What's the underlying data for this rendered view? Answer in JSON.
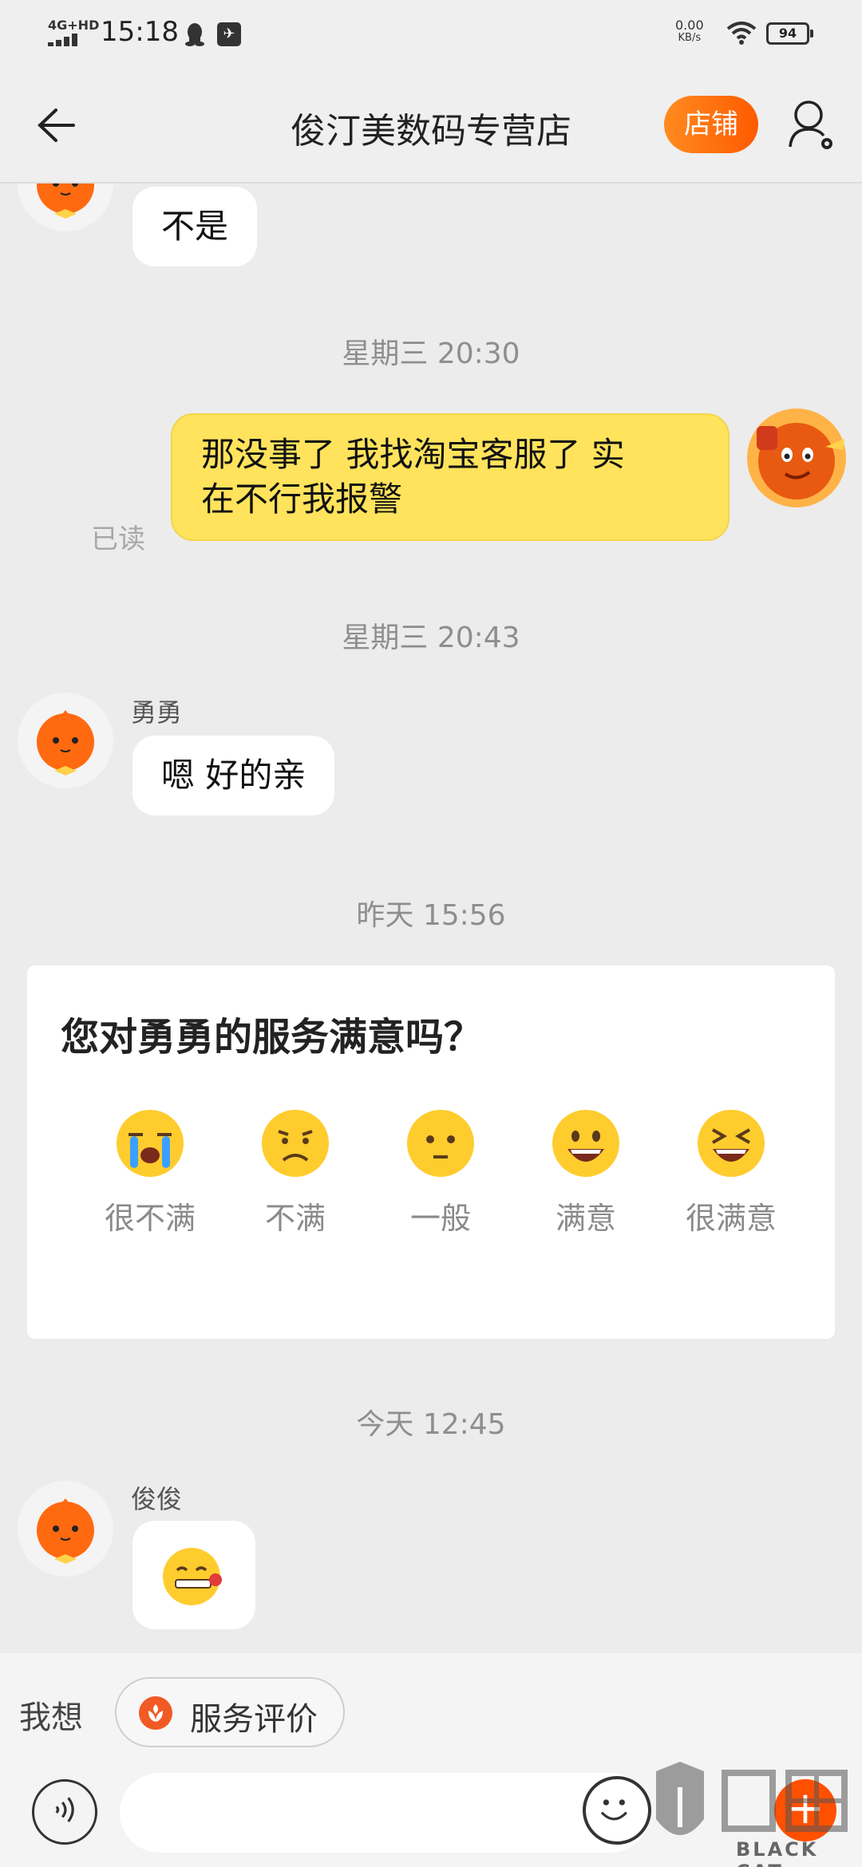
{
  "status_bar": {
    "network": "4G+HD",
    "time": "15:18",
    "speed_value": "0.00",
    "speed_unit": "KB/s",
    "battery": "94"
  },
  "header": {
    "title": "俊汀美数码专营店",
    "shop_button": "店铺"
  },
  "chat": {
    "messages": [
      {
        "type": "text",
        "from": "other",
        "text": "不是"
      },
      {
        "type": "time",
        "text": "星期三 20:30"
      },
      {
        "type": "text",
        "from": "me",
        "line1": "那没事了 我找淘宝客服了 实",
        "line2": "在不行我报警",
        "read": "已读"
      },
      {
        "type": "time",
        "text": "星期三 20:43"
      },
      {
        "type": "text",
        "from": "other",
        "sender": "勇勇",
        "text": "嗯  好的亲"
      },
      {
        "type": "time",
        "text": "昨天  15:56"
      },
      {
        "type": "time",
        "text": "今天  12:45"
      },
      {
        "type": "sticker",
        "from": "other",
        "sender": "俊俊",
        "icon": "blowing-kiss-emoji"
      }
    ],
    "rating": {
      "question": "您对勇勇的服务满意吗？",
      "options": [
        {
          "label": "很不满",
          "icon": "crying-face-icon"
        },
        {
          "label": "不满",
          "icon": "frowning-face-icon"
        },
        {
          "label": "一般",
          "icon": "neutral-face-icon"
        },
        {
          "label": "满意",
          "icon": "smiling-face-icon"
        },
        {
          "label": "很满意",
          "icon": "laughing-face-icon"
        }
      ]
    }
  },
  "quick_bar": {
    "label": "我想",
    "chip": "服务评价"
  },
  "input_bar": {
    "placeholder": "",
    "plus": "+"
  },
  "watermark": {
    "text": "BLACK CAT"
  },
  "colors": {
    "accent": "#ff5a00",
    "my_bubble": "#ffe35c",
    "background": "#ececec"
  }
}
